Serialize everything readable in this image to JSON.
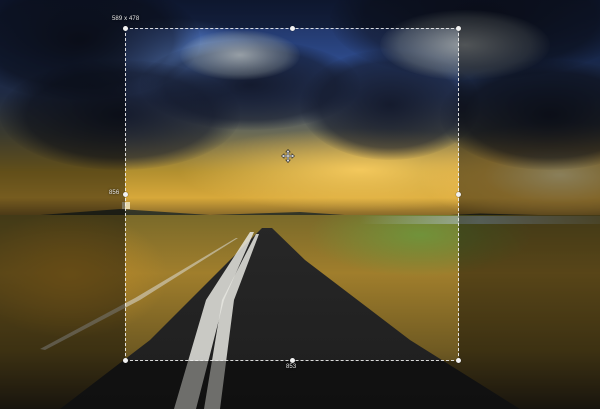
{
  "selection": {
    "size_label": "589 x 478",
    "left_label": "856",
    "bottom_label": "853"
  },
  "icons": {
    "move_cursor": "move-cursor-icon",
    "corner_handle": "handle-icon"
  },
  "colors": {
    "selection_border": "#f0f0f0",
    "outside_shade": "#000000",
    "handle": "#f2f2f2"
  }
}
